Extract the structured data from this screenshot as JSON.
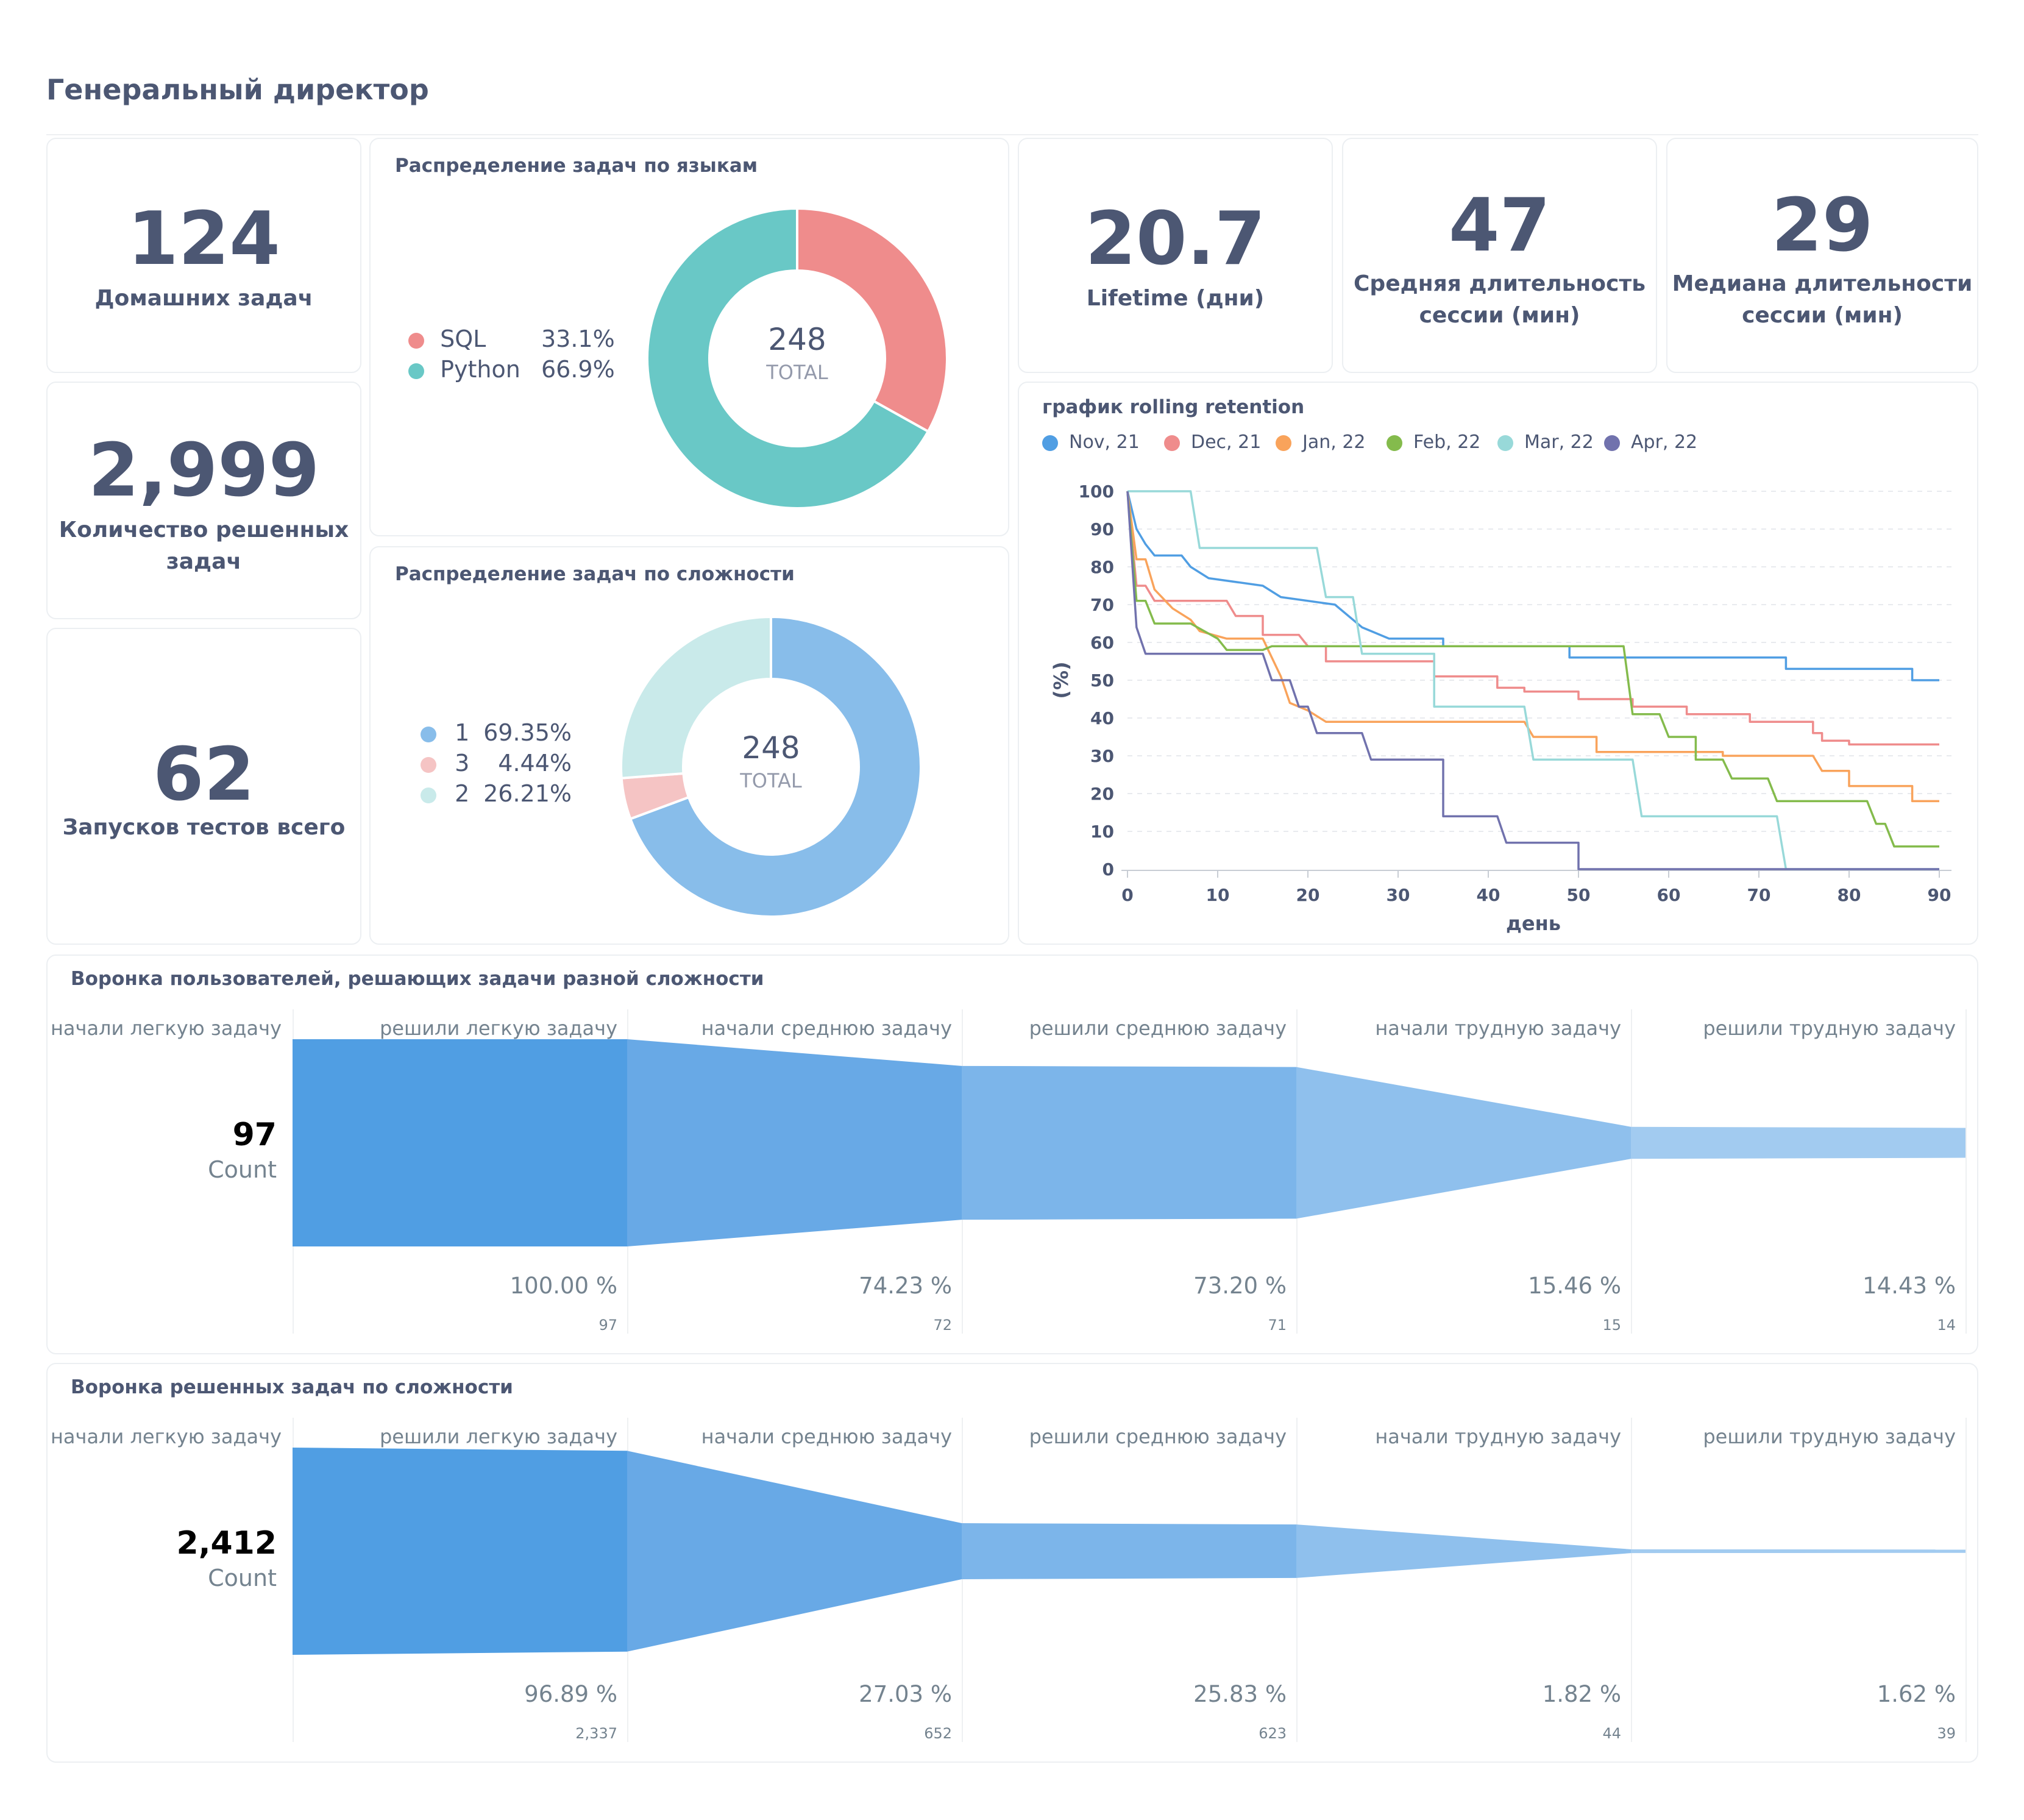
{
  "dashboard": {
    "title": "Генеральный директор"
  },
  "scalars": {
    "homework": {
      "value": "124",
      "label": "Домашних задач"
    },
    "solved": {
      "value": "2,999",
      "label_line1": "Количество решенных",
      "label_line2": "задач"
    },
    "test_runs": {
      "value": "62",
      "label": "Запусков тестов всего"
    },
    "lifetime": {
      "value": "20.7",
      "label": "Lifetime (дни)"
    },
    "avg_session": {
      "value": "47",
      "label_line1": "Средняя длительность",
      "label_line2": "сессии (мин)"
    },
    "median_session": {
      "value": "29",
      "label_line1": "Медиана длительности",
      "label_line2": "сессии (мин)"
    }
  },
  "lang_donut": {
    "title": "Распределение задач по языкам",
    "total": "248",
    "total_label": "TOTAL",
    "legend": [
      {
        "name": "SQL",
        "pct": "33.1%",
        "color": "#ef8c8c"
      },
      {
        "name": "Python",
        "pct": "66.9%",
        "color": "#69c8c6"
      }
    ]
  },
  "diff_donut": {
    "title": "Распределение задач по сложности",
    "total": "248",
    "total_label": "TOTAL",
    "legend": [
      {
        "name": "1",
        "pct": "69.35%",
        "color": "#88bdea"
      },
      {
        "name": "3",
        "pct": "4.44%",
        "color": "#f5c4c4"
      },
      {
        "name": "2",
        "pct": "26.21%",
        "color": "#c9eaea"
      }
    ]
  },
  "retention": {
    "title": "график rolling retention",
    "xlabel": "день",
    "ylabel": "(%)"
  },
  "funnel_users": {
    "title": "Воронка пользователей, решающих задачи разной сложности",
    "count_value": "97",
    "count_label": "Count",
    "stages": [
      "начали легкую задачу",
      "решили легкую задачу",
      "начали среднюю задачу",
      "решили среднюю задачу",
      "начали трудную задачу",
      "решили трудную задачу"
    ],
    "pcts": [
      "100.00 %",
      "74.23 %",
      "73.20 %",
      "15.46 %",
      "14.43 %"
    ],
    "counts": [
      "97",
      "72",
      "71",
      "15",
      "14"
    ]
  },
  "funnel_tasks": {
    "title": "Воронка решенных задач по сложности",
    "count_value": "2,412",
    "count_label": "Count",
    "stages": [
      "начали легкую задачу",
      "решили легкую задачу",
      "начали среднюю задачу",
      "решили среднюю задачу",
      "начали трудную задачу",
      "решили трудную задачу"
    ],
    "pcts": [
      "96.89 %",
      "27.03 %",
      "25.83 %",
      "1.82 %",
      "1.62 %"
    ],
    "counts": [
      "2,337",
      "652",
      "623",
      "44",
      "39"
    ]
  },
  "chart_data": [
    {
      "type": "pie",
      "title": "Распределение задач по языкам",
      "categories": [
        "SQL",
        "Python"
      ],
      "values": [
        33.1,
        66.9
      ],
      "total": 248,
      "colors": [
        "#ef8c8c",
        "#69c8c6"
      ]
    },
    {
      "type": "pie",
      "title": "Распределение задач по сложности",
      "categories": [
        "1",
        "3",
        "2"
      ],
      "values": [
        69.35,
        4.44,
        26.21
      ],
      "total": 248,
      "colors": [
        "#88bdea",
        "#f5c4c4",
        "#c9eaea"
      ]
    },
    {
      "type": "line",
      "title": "график rolling retention",
      "xlabel": "день",
      "ylabel": "(%)",
      "xlim": [
        0,
        90
      ],
      "ylim": [
        0,
        100
      ],
      "xticks": [
        0,
        10,
        20,
        30,
        40,
        50,
        60,
        70,
        80,
        90
      ],
      "yticks": [
        0,
        10,
        20,
        30,
        40,
        50,
        60,
        70,
        80,
        90,
        100
      ],
      "legend_position": "top-left",
      "series": [
        {
          "name": "Nov, 21",
          "color": "#509ee3",
          "points": [
            [
              0,
              100
            ],
            [
              1,
              90
            ],
            [
              2,
              86
            ],
            [
              3,
              83
            ],
            [
              6,
              83
            ],
            [
              7,
              80
            ],
            [
              9,
              77
            ],
            [
              15,
              75
            ],
            [
              17,
              72
            ],
            [
              23,
              70
            ],
            [
              26,
              64
            ],
            [
              27,
              63
            ],
            [
              29,
              61
            ],
            [
              35,
              61
            ],
            [
              35,
              59
            ],
            [
              49,
              59
            ],
            [
              49,
              56
            ],
            [
              73,
              56
            ],
            [
              73,
              53
            ],
            [
              87,
              53
            ],
            [
              87,
              50
            ],
            [
              90,
              50
            ]
          ]
        },
        {
          "name": "Dec, 21",
          "color": "#ef8c8c",
          "points": [
            [
              0,
              100
            ],
            [
              1,
              75
            ],
            [
              2,
              75
            ],
            [
              3,
              71
            ],
            [
              11,
              71
            ],
            [
              12,
              67
            ],
            [
              15,
              67
            ],
            [
              15,
              62
            ],
            [
              19,
              62
            ],
            [
              20,
              59
            ],
            [
              22,
              59
            ],
            [
              22,
              55
            ],
            [
              34,
              55
            ],
            [
              34,
              51
            ],
            [
              41,
              51
            ],
            [
              41,
              48
            ],
            [
              44,
              48
            ],
            [
              44,
              47
            ],
            [
              50,
              47
            ],
            [
              50,
              45
            ],
            [
              56,
              45
            ],
            [
              56,
              43
            ],
            [
              62,
              43
            ],
            [
              62,
              41
            ],
            [
              69,
              41
            ],
            [
              69,
              39
            ],
            [
              76,
              39
            ],
            [
              76,
              36
            ],
            [
              77,
              36
            ],
            [
              77,
              34
            ],
            [
              80,
              34
            ],
            [
              80,
              33
            ],
            [
              90,
              33
            ]
          ]
        },
        {
          "name": "Jan, 22",
          "color": "#f9a35b",
          "points": [
            [
              0,
              100
            ],
            [
              1,
              82
            ],
            [
              2,
              82
            ],
            [
              3,
              74
            ],
            [
              5,
              69
            ],
            [
              7,
              66
            ],
            [
              8,
              63
            ],
            [
              11,
              61
            ],
            [
              15,
              61
            ],
            [
              17,
              51
            ],
            [
              18,
              44
            ],
            [
              20,
              42
            ],
            [
              22,
              39
            ],
            [
              44,
              39
            ],
            [
              45,
              35
            ],
            [
              52,
              35
            ],
            [
              52,
              31
            ],
            [
              66,
              31
            ],
            [
              66,
              30
            ],
            [
              76,
              30
            ],
            [
              77,
              26
            ],
            [
              80,
              26
            ],
            [
              80,
              22
            ],
            [
              87,
              22
            ],
            [
              87,
              18
            ],
            [
              90,
              18
            ]
          ]
        },
        {
          "name": "Feb, 22",
          "color": "#84bb4c",
          "points": [
            [
              0,
              100
            ],
            [
              1,
              71
            ],
            [
              2,
              71
            ],
            [
              3,
              65
            ],
            [
              7,
              65
            ],
            [
              10,
              61
            ],
            [
              11,
              58
            ],
            [
              15,
              58
            ],
            [
              16,
              59
            ],
            [
              55,
              59
            ],
            [
              56,
              41
            ],
            [
              59,
              41
            ],
            [
              60,
              35
            ],
            [
              63,
              35
            ],
            [
              63,
              29
            ],
            [
              66,
              29
            ],
            [
              67,
              24
            ],
            [
              71,
              24
            ],
            [
              72,
              18
            ],
            [
              82,
              18
            ],
            [
              83,
              12
            ],
            [
              84,
              12
            ],
            [
              85,
              6
            ],
            [
              90,
              6
            ]
          ]
        },
        {
          "name": "Mar, 22",
          "color": "#98d9d9",
          "points": [
            [
              0,
              100
            ],
            [
              7,
              100
            ],
            [
              8,
              85
            ],
            [
              21,
              85
            ],
            [
              22,
              72
            ],
            [
              25,
              72
            ],
            [
              26,
              57
            ],
            [
              34,
              57
            ],
            [
              34,
              43
            ],
            [
              44,
              43
            ],
            [
              45,
              29
            ],
            [
              56,
              29
            ],
            [
              57,
              14
            ],
            [
              72,
              14
            ],
            [
              73,
              0
            ],
            [
              90,
              0
            ]
          ]
        },
        {
          "name": "Apr, 22",
          "color": "#7172ad",
          "points": [
            [
              0,
              100
            ],
            [
              1,
              64
            ],
            [
              2,
              57
            ],
            [
              15,
              57
            ],
            [
              16,
              50
            ],
            [
              18,
              50
            ],
            [
              19,
              43
            ],
            [
              20,
              43
            ],
            [
              21,
              36
            ],
            [
              26,
              36
            ],
            [
              27,
              29
            ],
            [
              35,
              29
            ],
            [
              35,
              14
            ],
            [
              41,
              14
            ],
            [
              42,
              7
            ],
            [
              50,
              7
            ],
            [
              50,
              0
            ],
            [
              90,
              0
            ]
          ]
        }
      ]
    },
    {
      "type": "area",
      "title": "Воронка пользователей, решающих задачи разной сложности",
      "categories": [
        "начали легкую задачу",
        "решили легкую задачу",
        "начали среднюю задачу",
        "решили среднюю задачу",
        "начали трудную задачу",
        "решили трудную задачу"
      ],
      "values": [
        97,
        97,
        72,
        71,
        15,
        14
      ],
      "percent_labels": [
        "100.00 %",
        "74.23 %",
        "73.20 %",
        "15.46 %",
        "14.43 %"
      ]
    },
    {
      "type": "area",
      "title": "Воронка решенных задач по сложности",
      "categories": [
        "начали легкую задачу",
        "решили легкую задачу",
        "начали среднюю задачу",
        "решили среднюю задачу",
        "начали трудную задачу",
        "решили трудную задачу"
      ],
      "values": [
        2412,
        2337,
        652,
        623,
        44,
        39
      ],
      "percent_labels": [
        "96.89 %",
        "27.03 %",
        "25.83 %",
        "1.82 %",
        "1.62 %"
      ]
    }
  ]
}
